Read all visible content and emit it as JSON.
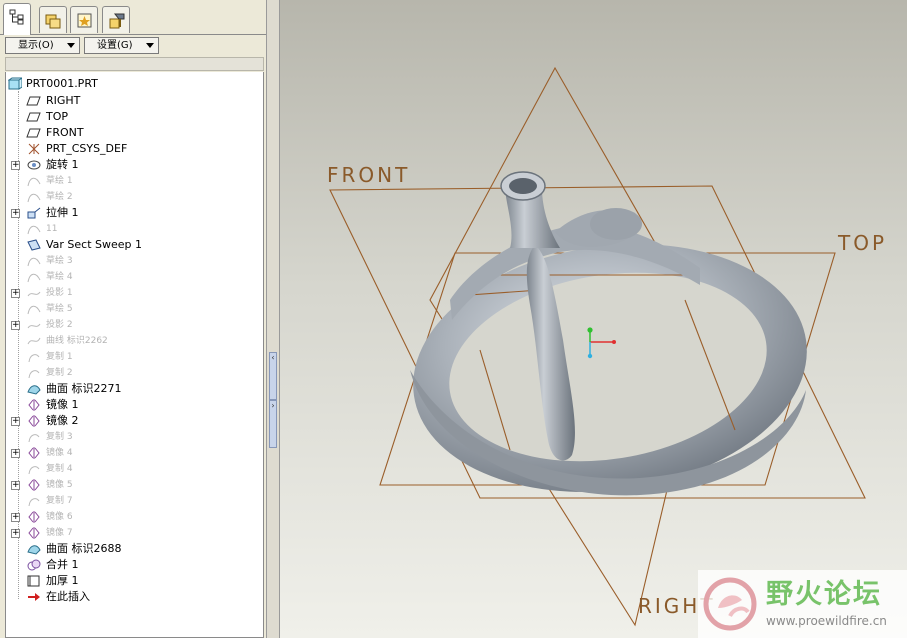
{
  "tabs": [
    {
      "name": "model-tree",
      "icon": "model-tree-icon",
      "active": true
    },
    {
      "name": "folder-browser",
      "icon": "folder-browser-icon",
      "active": false
    },
    {
      "name": "favorites",
      "icon": "favorites-icon",
      "active": false
    },
    {
      "name": "connections",
      "icon": "connections-icon",
      "active": false
    }
  ],
  "toolbar": {
    "show_label": "显示(O)",
    "settings_label": "设置(G)"
  },
  "tree": {
    "root": "PRT0001.PRT",
    "items": [
      {
        "label": "RIGHT",
        "icon": "datum-plane-icon",
        "dim": false
      },
      {
        "label": "TOP",
        "icon": "datum-plane-icon",
        "dim": false
      },
      {
        "label": "FRONT",
        "icon": "datum-plane-icon",
        "dim": false
      },
      {
        "label": "PRT_CSYS_DEF",
        "icon": "csys-icon",
        "dim": false
      },
      {
        "label": "旋转 1",
        "icon": "revolve-icon",
        "dim": false,
        "expander": true
      },
      {
        "label": "草绘 1",
        "icon": "sketch-icon",
        "dim": true
      },
      {
        "label": "草绘 2",
        "icon": "sketch-icon",
        "dim": true
      },
      {
        "label": "拉伸 1",
        "icon": "extrude-icon",
        "dim": false,
        "expander": true
      },
      {
        "label": "11",
        "icon": "sketch-icon",
        "dim": true
      },
      {
        "label": "Var Sect Sweep 1",
        "icon": "sweep-icon",
        "dim": false
      },
      {
        "label": "草绘 3",
        "icon": "sketch-icon",
        "dim": true
      },
      {
        "label": "草绘 4",
        "icon": "sketch-icon",
        "dim": true
      },
      {
        "label": "投影 1",
        "icon": "projection-icon",
        "dim": true,
        "expander": true
      },
      {
        "label": "草绘 5",
        "icon": "sketch-icon",
        "dim": true
      },
      {
        "label": "投影 2",
        "icon": "projection-icon",
        "dim": true,
        "expander": true
      },
      {
        "label": "曲线 标识2262",
        "icon": "curve-icon",
        "dim": true
      },
      {
        "label": "复制 1",
        "icon": "copy-icon",
        "dim": true
      },
      {
        "label": "复制 2",
        "icon": "copy-icon",
        "dim": true
      },
      {
        "label": "曲面 标识2271",
        "icon": "surface-icon",
        "dim": false
      },
      {
        "label": "镜像 1",
        "icon": "mirror-icon",
        "dim": false
      },
      {
        "label": "镜像 2",
        "icon": "mirror-icon",
        "dim": false,
        "expander": true
      },
      {
        "label": "复制 3",
        "icon": "copy-icon",
        "dim": true
      },
      {
        "label": "镜像 4",
        "icon": "mirror-icon",
        "dim": true,
        "expander": true
      },
      {
        "label": "复制 4",
        "icon": "copy-icon",
        "dim": true
      },
      {
        "label": "镜像 5",
        "icon": "mirror-icon",
        "dim": true,
        "expander": true
      },
      {
        "label": "复制 7",
        "icon": "copy-icon",
        "dim": true
      },
      {
        "label": "镜像 6",
        "icon": "mirror-icon",
        "dim": true,
        "expander": true
      },
      {
        "label": "镜像 7",
        "icon": "mirror-icon",
        "dim": true,
        "expander": true
      },
      {
        "label": "曲面 标识2688",
        "icon": "surface-icon",
        "dim": false
      },
      {
        "label": "合并 1",
        "icon": "merge-icon",
        "dim": false
      },
      {
        "label": "加厚 1",
        "icon": "thicken-icon",
        "dim": false
      },
      {
        "label": "在此插入",
        "icon": "insert-here-arrow-icon",
        "dim": false
      }
    ]
  },
  "viewport": {
    "datum_labels": {
      "front": "FRONT",
      "top": "TOP",
      "right": "RIGHT"
    },
    "datum_color": "#9a5e2a",
    "part_color": "#a9b0b8"
  },
  "watermark": {
    "title": "野火论坛",
    "url": "www.proewildfire.cn"
  }
}
